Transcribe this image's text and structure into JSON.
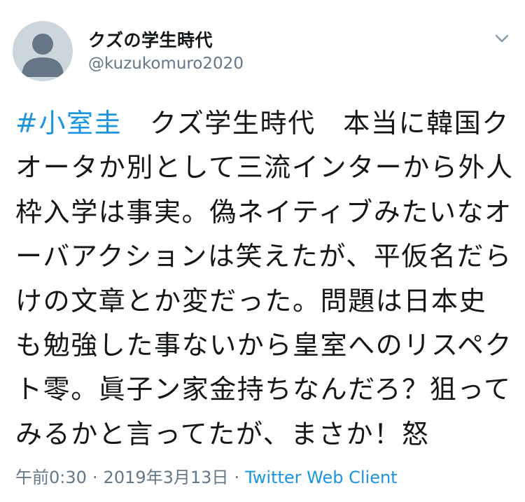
{
  "user": {
    "display_name": "クズの学生時代",
    "handle": "@kuzukomuro2020",
    "avatar_icon": "default-avatar-icon"
  },
  "menu": {
    "icon": "chevron-down-icon"
  },
  "tweet": {
    "hashtag": "#小室圭",
    "body": "　クズ学生時代　本当に韓国クオータか別として三流インターから外人枠入学は事実。偽ネイティブみたいなオーバアクションは笑えたが、平仮名だらけの文章とか変だった。問題は日本史も勉強した事ないから皇室へのリスペクト零。眞子ン家金持ちなんだろ？狙ってみるかと言ってたが、まさか！怒"
  },
  "meta": {
    "time": "午前0:30",
    "separator": "·",
    "date": "2019年3月13日",
    "source": "Twitter Web Client"
  },
  "colors": {
    "link": "#1b95e0",
    "secondary": "#657786",
    "text": "#14171a",
    "avatar_bg": "#ccd6dd",
    "avatar_fg": "#657786"
  }
}
